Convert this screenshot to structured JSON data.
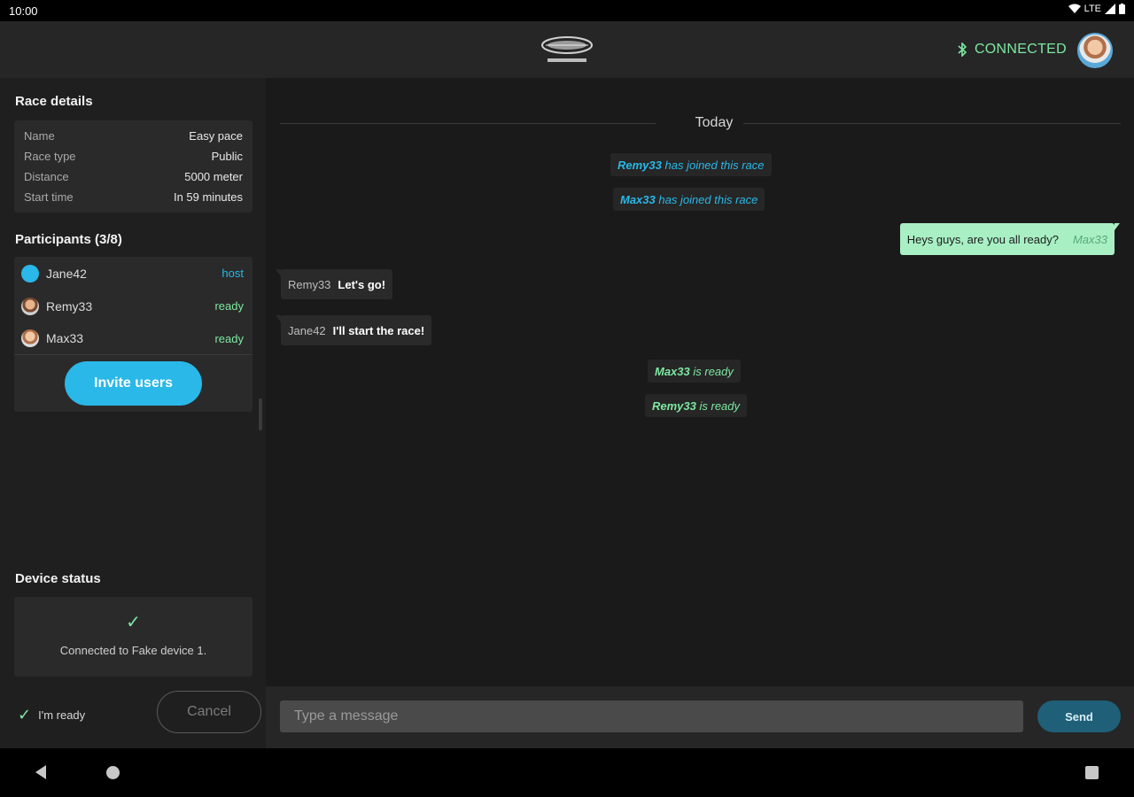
{
  "status_bar": {
    "time": "10:00",
    "network": "LTE"
  },
  "header": {
    "logo_alt": "WaterRower",
    "connection_status": "CONNECTED",
    "colors": {
      "connected": "#7ee8a2"
    }
  },
  "race_details": {
    "title": "Race details",
    "rows": [
      {
        "label": "Name",
        "value": "Easy pace"
      },
      {
        "label": "Race type",
        "value": "Public"
      },
      {
        "label": "Distance",
        "value": "5000 meter"
      },
      {
        "label": "Start time",
        "value": "In 59 minutes"
      }
    ]
  },
  "participants": {
    "title": "Participants (3/8)",
    "items": [
      {
        "name": "Jane42",
        "role": "host",
        "role_color": "#29b8e8"
      },
      {
        "name": "Remy33",
        "role": "ready",
        "role_color": "#7ee8a2"
      },
      {
        "name": "Max33",
        "role": "ready",
        "role_color": "#7ee8a2"
      }
    ],
    "invite_label": "Invite users"
  },
  "device_status": {
    "title": "Device status",
    "message": "Connected to Fake device 1."
  },
  "footer_left": {
    "ready_label": "I'm ready",
    "cancel_label": "Cancel"
  },
  "chat": {
    "date_divider": "Today",
    "messages": [
      {
        "kind": "system",
        "user": "Remy33",
        "text": "has joined this race"
      },
      {
        "kind": "system",
        "user": "Max33",
        "text": "has joined this race"
      },
      {
        "kind": "outgoing",
        "text": "Heys guys, are you all ready?",
        "user": "Max33"
      },
      {
        "kind": "incoming",
        "user": "Remy33",
        "text": "Let's go!"
      },
      {
        "kind": "incoming",
        "user": "Jane42",
        "text": "I'll start the race!"
      },
      {
        "kind": "system",
        "user": "Max33",
        "text": "is ready"
      },
      {
        "kind": "system",
        "user": "Remy33",
        "text": "is ready"
      }
    ]
  },
  "composer": {
    "placeholder": "Type a message",
    "send_label": "Send"
  }
}
